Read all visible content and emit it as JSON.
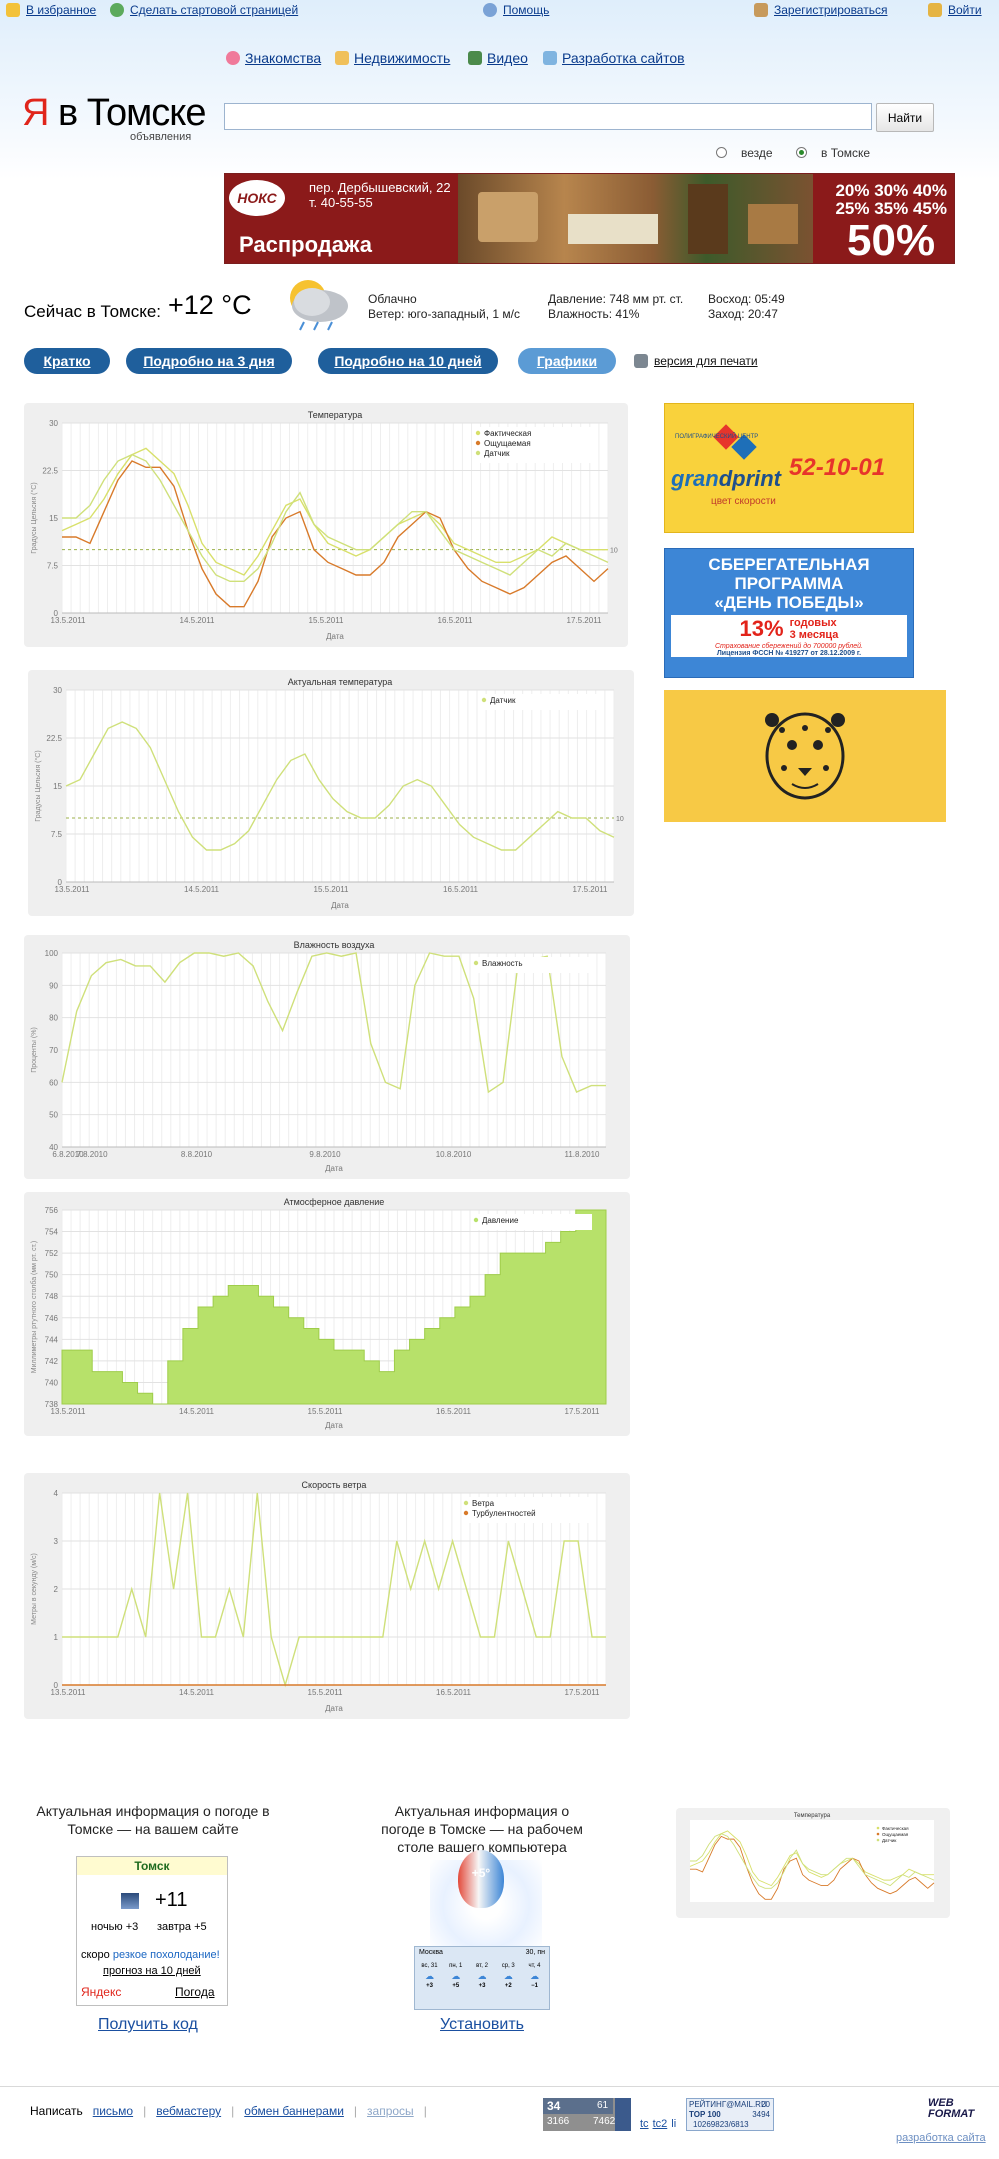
{
  "topbar": {
    "favorites": "В избранное",
    "start_page": "Сделать стартовой страницей",
    "help": "Помощь",
    "register": "Зарегистрироваться",
    "login": "Войти"
  },
  "nav": [
    "Знакомства",
    "Недвижимость",
    "Видео",
    "Разработка сайтов"
  ],
  "logo": {
    "ya": "Я",
    "rest": "в Томске",
    "sub": "объявления"
  },
  "search": {
    "button": "Найти",
    "opt_everywhere": "везде",
    "opt_tomsk": "в Томске",
    "value": ""
  },
  "banner": {
    "address": "пер. Дербышевский, 22",
    "phone": "т. 40-55-55",
    "sale": "Распродажа",
    "pcts": "20% 30% 40%",
    "pcts2": "25% 35% 45%",
    "big": "50%",
    "brand": "НОКС"
  },
  "weather": {
    "label": "Сейчас в Томске:",
    "temp": "+12 °C",
    "cond": "Облачно",
    "wind": "Ветер: юго-западный, 1 м/с",
    "pressure": "Давление: 748 мм рт. ст.",
    "humidity": "Влажность: 41%",
    "sunrise": "Восход: 05:49",
    "sunset": "Заход: 20:47"
  },
  "tabs": [
    "Кратко",
    "Подробно на 3 дня",
    "Подробно на 10 дней",
    "Графики"
  ],
  "print": "версия для печати",
  "ads": {
    "grand": {
      "top": "ПОЛИГРАФИЧЕСКИЙ ЦЕНТР",
      "name1": "gran",
      "name2": "dprint",
      "slogan": "цвет скорости",
      "phone": "52-10-01"
    },
    "bank": {
      "l1": "СБЕРЕГАТЕЛЬНАЯ",
      "l2": "ПРОГРАММА",
      "l3": "«ДЕНЬ ПОБЕДЫ»",
      "pct": "13%",
      "pct_t1": "годовых",
      "pct_t2": "3 месяца",
      "note": "Страхование сбережений до 700000 рублей.",
      "lic": "Лицензия ФССН № 419277 от 28.12.2009 г."
    }
  },
  "promo": {
    "site": {
      "text": "Актуальная информация о погоде в Томске — на вашем сайте",
      "city": "Томск",
      "temp": "+11",
      "night": "ночью +3",
      "tomorrow": "завтра +5",
      "soon_prefix": "скоро",
      "soon_link": "резкое похолодание!",
      "forecast": "прогноз на 10 дней",
      "brand": "Яндекс",
      "brand2": "Погода",
      "action": "Получить код"
    },
    "desk": {
      "text": "Актуальная информация о погоде в Томске — на рабочем столе вашего компьютера",
      "balloon": "+5°",
      "city": "Москва",
      "date": "30, пн",
      "days": [
        "вс, 31",
        "пн, 1",
        "вт, 2",
        "ср, 3",
        "чт, 4"
      ],
      "vals": [
        "+3",
        "+5",
        "+3",
        "+2",
        "−1"
      ],
      "action": "Установить"
    },
    "thumb": {
      "title": "Температура"
    }
  },
  "footer": {
    "prefix": "Написать",
    "links": [
      "письмо",
      "вебмастеру",
      "обмен баннерами",
      "запросы"
    ],
    "counters": {
      "a": "34",
      "b": "61",
      "c": "3166",
      "d": "7462",
      "tc": "tc",
      "tc2": "tc2",
      "li": "li",
      "top100": "TOP 100",
      "rk": "3494",
      "rk2": "10269823/6813",
      "mail": "РЕЙТИНГ@MAIL.RU",
      "mailn": "20"
    },
    "webformat": "WEB FORMAT",
    "dev": "разработка сайта"
  },
  "colors": {
    "link": "#0a3b8c",
    "accent": "#1f5f9c",
    "pill_active": "#5b9bd5",
    "fact": "#d8e06a",
    "feel": "#d87a2a",
    "sensor": "#cfe07a",
    "pressure": "#b7e16a"
  },
  "chart_data": [
    {
      "type": "line",
      "title": "Температура",
      "xlabel": "Дата",
      "ylabel": "Градусы Цельсия (°C)",
      "ylim": [
        0,
        30
      ],
      "yticks": [
        0,
        7.5,
        15,
        22.5,
        30
      ],
      "categories": [
        "13.5.2011",
        "14.5.2011",
        "15.5.2011",
        "16.5.2011",
        "17.5.2011"
      ],
      "legend": "top-right",
      "ref": 10,
      "refLabel": "10",
      "series": [
        {
          "name": "Фактическая",
          "color": "#d8e06a",
          "values": [
            13,
            14,
            15,
            18,
            22,
            25,
            26,
            24,
            22,
            17,
            11,
            8,
            7,
            6,
            9,
            13,
            17,
            18,
            14,
            11,
            10,
            9,
            10,
            12,
            14,
            15,
            16,
            14,
            11,
            10,
            9,
            8,
            8,
            9,
            10,
            12,
            11,
            10,
            10,
            10
          ]
        },
        {
          "name": "Ощущаемая",
          "color": "#d87a2a",
          "values": [
            12,
            12,
            11,
            16,
            21,
            24,
            23,
            23,
            20,
            13,
            7,
            3,
            1,
            1,
            5,
            12,
            15,
            16,
            10,
            8,
            7,
            6,
            6,
            8,
            12,
            14,
            16,
            15,
            10,
            7,
            5,
            4,
            3,
            4,
            6,
            8,
            9,
            7,
            5,
            7
          ]
        },
        {
          "name": "Датчик",
          "color": "#cfe07a",
          "values": [
            15,
            15,
            17,
            21,
            24,
            25,
            24,
            21,
            17,
            13,
            9,
            6,
            5,
            5,
            7,
            11,
            16,
            19,
            14,
            12,
            11,
            10,
            10,
            12,
            14,
            16,
            16,
            13,
            10,
            9,
            8,
            7,
            6,
            8,
            10,
            9,
            11,
            10,
            9,
            8
          ]
        }
      ]
    },
    {
      "type": "line",
      "title": "Актуальная температура",
      "xlabel": "Дата",
      "ylabel": "Градусы Цельсия (°C)",
      "ylim": [
        0,
        30
      ],
      "yticks": [
        0,
        7.5,
        15,
        22.5,
        30
      ],
      "categories": [
        "13.5.2011",
        "14.5.2011",
        "15.5.2011",
        "16.5.2011",
        "17.5.2011"
      ],
      "legend": "top-right",
      "ref": 10,
      "refLabel": "10",
      "series": [
        {
          "name": "Датчик",
          "color": "#cfe07a",
          "values": [
            15,
            16,
            20,
            24,
            25,
            24,
            21,
            16,
            11,
            7,
            5,
            5,
            6,
            8,
            12,
            16,
            19,
            20,
            16,
            13,
            11,
            10,
            10,
            12,
            15,
            16,
            15,
            12,
            9,
            7,
            6,
            5,
            5,
            7,
            9,
            11,
            10,
            10,
            8,
            7
          ]
        }
      ]
    },
    {
      "type": "line",
      "title": "Влажность воздуха",
      "xlabel": "Дата",
      "ylabel": "Проценты (%)",
      "ylim": [
        40,
        100
      ],
      "yticks": [
        40,
        50,
        60,
        70,
        80,
        90,
        100
      ],
      "categories": [
        "6.8.2010",
        "8.8.2010",
        "9.8.2010",
        "10.8.2010",
        "11.8.2010"
      ],
      "extra_tick": "7.8.2010",
      "legend": "top-right",
      "series": [
        {
          "name": "Влажность",
          "color": "#cfe07a",
          "values": [
            60,
            82,
            93,
            97,
            98,
            96,
            96,
            91,
            97,
            100,
            100,
            99,
            100,
            96,
            85,
            76,
            88,
            99,
            100,
            99,
            100,
            72,
            60,
            58,
            90,
            100,
            99,
            99,
            86,
            57,
            60,
            96,
            98,
            99,
            68,
            57,
            59,
            59
          ]
        }
      ]
    },
    {
      "type": "area",
      "title": "Атмосферное давление",
      "xlabel": "Дата",
      "ylabel": "Миллиметры ртутного столба (мм рт. ст.)",
      "ylim": [
        738,
        756
      ],
      "yticks": [
        738,
        740,
        742,
        744,
        746,
        748,
        750,
        752,
        754,
        756
      ],
      "categories": [
        "13.5.2011",
        "14.5.2011",
        "15.5.2011",
        "16.5.2011",
        "17.5.2011"
      ],
      "legend": "top-right",
      "series": [
        {
          "name": "Давление",
          "color": "#b7e16a",
          "values": [
            743,
            743,
            741,
            741,
            740,
            739,
            738,
            742,
            745,
            747,
            748,
            749,
            749,
            748,
            747,
            746,
            745,
            744,
            743,
            743,
            742,
            741,
            743,
            744,
            745,
            746,
            747,
            748,
            750,
            752,
            752,
            752,
            753,
            754,
            756,
            756,
            756
          ]
        }
      ]
    },
    {
      "type": "line",
      "title": "Скорость ветра",
      "xlabel": "Дата",
      "ylabel": "Метры в секунду (м/с)",
      "ylim": [
        0,
        4
      ],
      "yticks": [
        0,
        1,
        2,
        3,
        4
      ],
      "categories": [
        "13.5.2011",
        "14.5.2011",
        "15.5.2011",
        "16.5.2011",
        "17.5.2011"
      ],
      "legend": "top-right",
      "series": [
        {
          "name": "Ветра",
          "color": "#cfe07a",
          "values": [
            1,
            1,
            1,
            1,
            1,
            2,
            1,
            4,
            2,
            4,
            1,
            1,
            2,
            1,
            4,
            1,
            0,
            1,
            1,
            1,
            1,
            1,
            1,
            1,
            3,
            2,
            3,
            2,
            3,
            2,
            1,
            1,
            3,
            2,
            1,
            1,
            3,
            3,
            1,
            1
          ]
        },
        {
          "name": "Турбулентностей",
          "color": "#d87a2a",
          "values": [
            0,
            0,
            0,
            0,
            0,
            0,
            0,
            0,
            0,
            0,
            0,
            0,
            0,
            0,
            0,
            0,
            0,
            0,
            0,
            0,
            0,
            0,
            0,
            0,
            0,
            0,
            0,
            0,
            0,
            0,
            0,
            0,
            0,
            0,
            0,
            0,
            0,
            0,
            0,
            0
          ]
        }
      ]
    }
  ]
}
